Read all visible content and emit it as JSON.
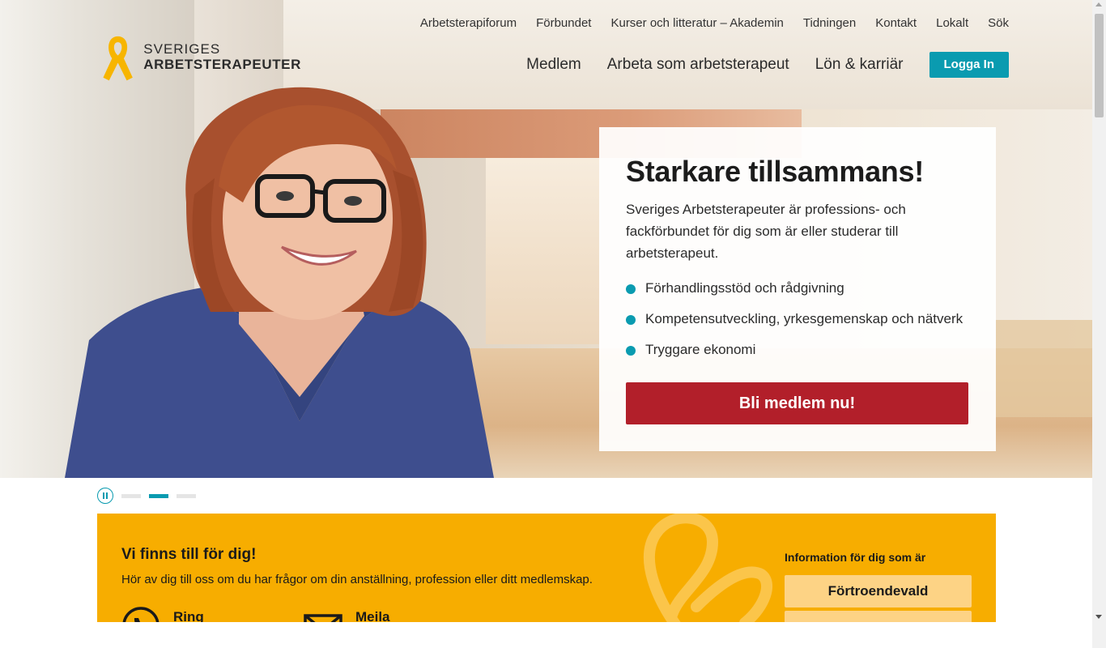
{
  "header": {
    "logo": {
      "line1": "SVERIGES",
      "line2": "ARBETSTERAPEUTER",
      "icon": "ribbon-logo-icon"
    },
    "top_links": [
      "Arbetsterapiforum",
      "Förbundet",
      "Kurser och litteratur – Akademin",
      "Tidningen",
      "Kontakt",
      "Lokalt",
      "Sök"
    ],
    "main_links": [
      "Medlem",
      "Arbeta som arbetsterapeut",
      "Lön & karriär"
    ],
    "login_label": "Logga In"
  },
  "hero": {
    "title": "Starkare tillsammans!",
    "intro": "Sveriges Arbetsterapeuter är professions- och fackförbundet för dig som är eller studerar till arbetsterapeut.",
    "bullets": [
      "Förhandlingsstöd och rådgivning",
      "Kompetensutveckling, yrkesgemenskap och nätverk",
      "Tryggare ekonomi"
    ],
    "cta_label": "Bli medlem nu!"
  },
  "slider": {
    "pause_icon": "pause-icon",
    "active_index": 1,
    "count": 3
  },
  "panel": {
    "title": "Vi finns till för dig!",
    "subtitle": "Hör av dig till oss om du har frågor om din anställning, profession eller ditt medlemskap.",
    "contacts": [
      {
        "label": "Ring",
        "icon": "phone-icon"
      },
      {
        "label": "Meila",
        "icon": "mail-icon"
      }
    ],
    "info_title": "Information för dig som är",
    "info_options": [
      "Förtroendevald"
    ]
  },
  "colors": {
    "teal": "#0a9bb0",
    "red": "#b21f2a",
    "yellow": "#f7ad00",
    "logo_yellow": "#f7b500"
  }
}
